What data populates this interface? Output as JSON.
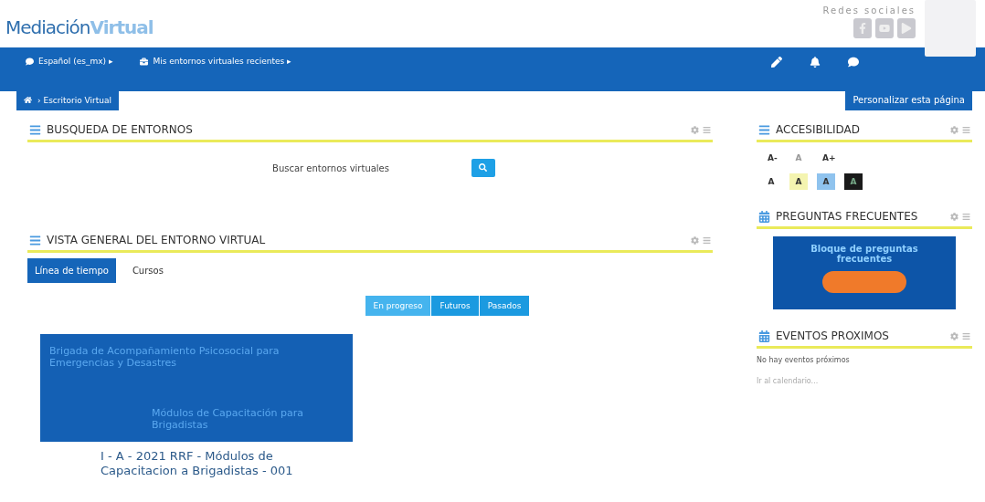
{
  "logo": {
    "first": "Mediación",
    "second": "Virtual"
  },
  "social": {
    "title": "Redes sociales"
  },
  "navbar": {
    "items": [
      {
        "label": "Español (es_mx) ▸"
      },
      {
        "label": "Mis entornos virtuales recientes ▸"
      }
    ]
  },
  "breadcrumb": {
    "label": "› Escritorio Virtual"
  },
  "customize_button": "Personalizar esta página",
  "search_block": {
    "title": "BUSQUEDA DE ENTORNOS",
    "label": "Buscar entornos virtuales"
  },
  "overview_block": {
    "title": "VISTA GENERAL DEL ENTORNO VIRTUAL",
    "tabs": [
      {
        "label": "Línea de tiempo",
        "selected": true
      },
      {
        "label": "Cursos",
        "selected": false
      }
    ],
    "filters": [
      {
        "label": "En progreso",
        "selected": true
      },
      {
        "label": "Futuros",
        "selected": false
      },
      {
        "label": "Pasados",
        "selected": false
      }
    ],
    "course": {
      "banner_top": "Brigada de Acompañamiento Psicosocial para Emergencias y Desastres",
      "banner_bottom": "Módulos de Capacitación para Brigadistas",
      "name": "I - A - 2021   RRF - Módulos de Capacitacion a Brigadistas - 001"
    }
  },
  "accessibility": {
    "title": "ACCESIBILIDAD",
    "size_buttons": [
      {
        "label": "A-",
        "disabled": false
      },
      {
        "label": "A",
        "disabled": true
      },
      {
        "label": "A+",
        "disabled": false
      }
    ],
    "contrast_buttons": [
      {
        "label": "A",
        "color": "#ffffff"
      },
      {
        "label": "A",
        "color": "#f4f4b0"
      },
      {
        "label": "A",
        "color": "#8fc3ee"
      },
      {
        "label": "A",
        "color": "#1a1a1a"
      }
    ]
  },
  "faq": {
    "title": "PREGUNTAS FRECUENTES",
    "banner": "Bloque de preguntas frecuentes"
  },
  "events": {
    "title": "EVENTOS PROXIMOS",
    "empty": "No hay eventos próximos",
    "link": "Ir al calendario..."
  }
}
